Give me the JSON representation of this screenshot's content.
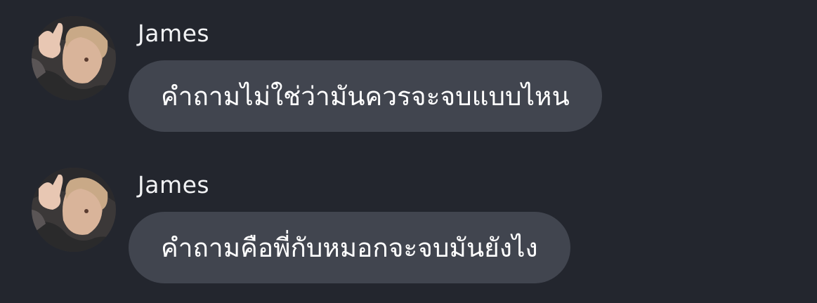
{
  "messages": [
    {
      "sender": "James",
      "text": "คำถามไม่ใช่ว่ามันควรจะจบแบบไหน"
    },
    {
      "sender": "James",
      "text": "คำถามคือพี่กับหมอกจะจบมันยังไง"
    }
  ],
  "colors": {
    "background": "#23262e",
    "bubble": "#41454f",
    "text": "#ffffff",
    "sender": "#f2f3f5"
  }
}
